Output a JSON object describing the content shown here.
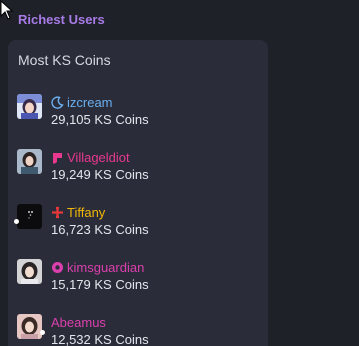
{
  "section_title": "Richest Users",
  "card_title": "Most KS Coins",
  "colors": {
    "section_title": "#a77be6",
    "card_bg": "#2a2d39",
    "page_bg": "#1f2129"
  },
  "users": [
    {
      "name": "izcream",
      "coins": "29,105 KS Coins",
      "name_color": "#6aaef0",
      "badge_icon": "moon-icon"
    },
    {
      "name": "Villageldiot",
      "coins": "19,249 KS Coins",
      "name_color": "#e8388f",
      "badge_icon": "flag-icon"
    },
    {
      "name": "Tiffany",
      "coins": "16,723 KS Coins",
      "name_color": "#f2b705",
      "badge_icon": "plane-icon"
    },
    {
      "name": "kimsguardian",
      "coins": "15,179 KS Coins",
      "name_color": "#dc3fae",
      "badge_icon": "circle-badge-icon"
    },
    {
      "name": "Abeamus",
      "coins": "12,532 KS Coins",
      "name_color": "#dc3fae",
      "badge_icon": ""
    }
  ]
}
